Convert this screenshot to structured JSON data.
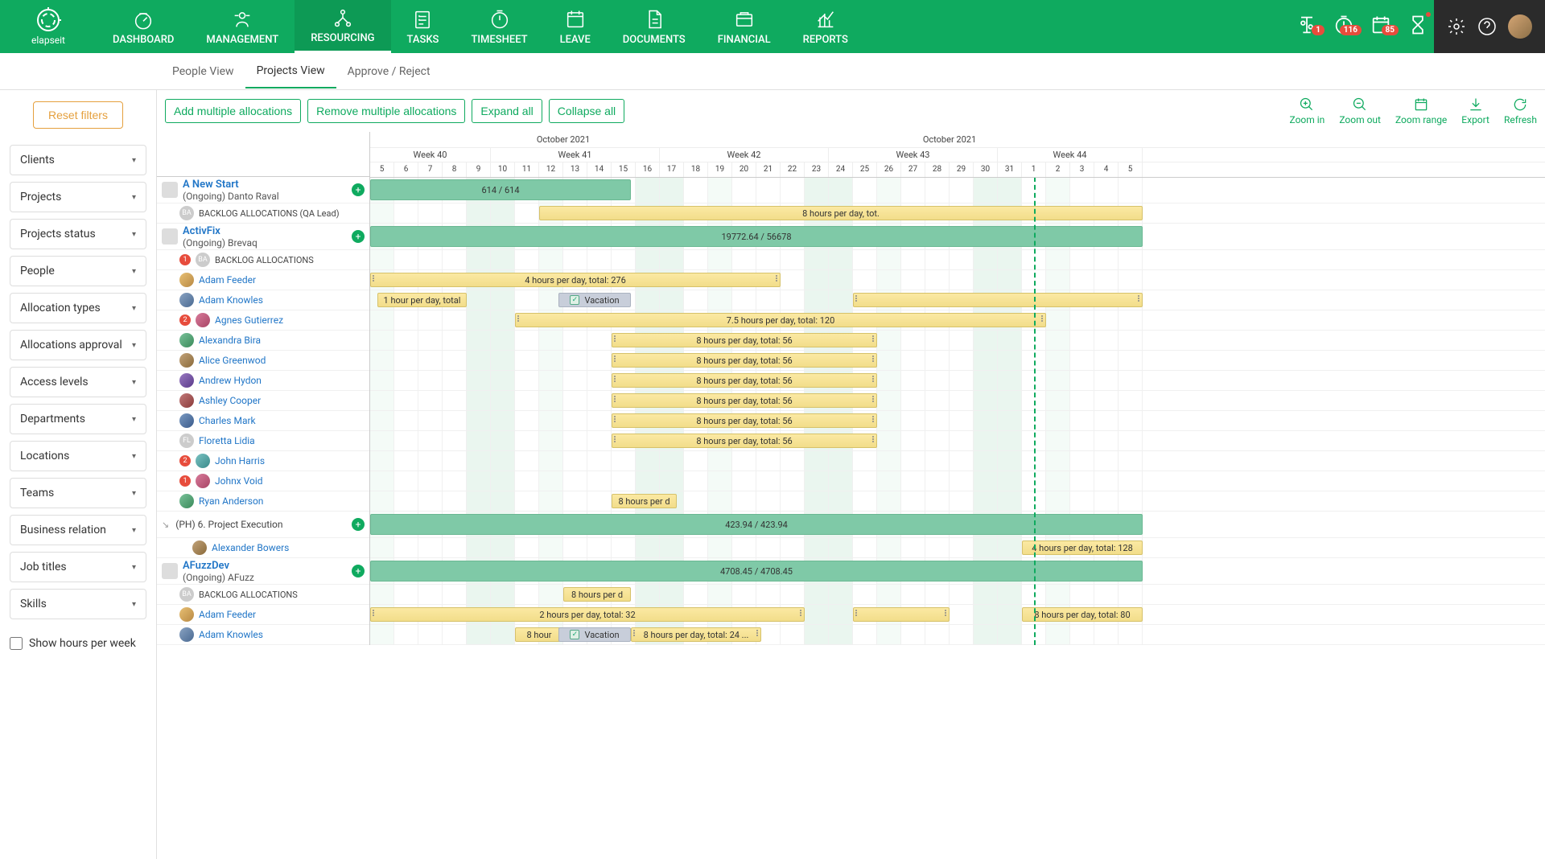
{
  "brand": "elapseit",
  "nav": [
    {
      "label": "DASHBOARD"
    },
    {
      "label": "MANAGEMENT"
    },
    {
      "label": "RESOURCING"
    },
    {
      "label": "TASKS"
    },
    {
      "label": "TIMESHEET"
    },
    {
      "label": "LEAVE"
    },
    {
      "label": "DOCUMENTS"
    },
    {
      "label": "FINANCIAL"
    },
    {
      "label": "REPORTS"
    }
  ],
  "nav_active": 2,
  "header_badges": {
    "bell": "1",
    "timer": "116",
    "cal": "85"
  },
  "sub_tabs": [
    "People View",
    "Projects View",
    "Approve / Reject"
  ],
  "sub_tab_active": 1,
  "toolbar": {
    "add": "Add multiple allocations",
    "remove": "Remove multiple allocations",
    "expand": "Expand all",
    "collapse": "Collapse all",
    "zoom_in": "Zoom in",
    "zoom_out": "Zoom out",
    "zoom_range": "Zoom range",
    "export": "Export",
    "refresh": "Refresh"
  },
  "sidebar": {
    "reset": "Reset filters",
    "filters": [
      "Clients",
      "Projects",
      "Projects status",
      "People",
      "Allocation types",
      "Allocations approval",
      "Access levels",
      "Departments",
      "Locations",
      "Teams",
      "Business relation",
      "Job titles",
      "Skills"
    ],
    "show_hours": "Show hours per week"
  },
  "timeline": {
    "month": "October 2021",
    "weeks": [
      "Week 40",
      "Week 41",
      "Week 42",
      "Week 43",
      "Week 44"
    ],
    "days": [
      "5",
      "6",
      "7",
      "8",
      "9",
      "10",
      "11",
      "12",
      "13",
      "14",
      "15",
      "16",
      "17",
      "18",
      "19",
      "20",
      "21",
      "22",
      "23",
      "24",
      "25",
      "26",
      "27",
      "28",
      "29",
      "30",
      "31",
      "1",
      "2",
      "3",
      "4",
      "5"
    ],
    "weekend_idx": [
      4,
      5,
      11,
      12,
      18,
      19,
      25,
      26
    ],
    "tue_idx": [
      0,
      7,
      14,
      21,
      28
    ],
    "today_idx": 27.5
  },
  "projects": [
    {
      "name": "A New Start",
      "sub": "(Ongoing) Danto Raval",
      "bar": {
        "start": 0,
        "end": 10.8,
        "label": "614 / 614"
      },
      "rows": [
        {
          "type": "ba",
          "label": "BACKLOG ALLOCATIONS (QA Lead)",
          "bars": [
            {
              "start": 7,
              "end": 32,
              "label": "8 hours per day, tot.",
              "cls": "bar-alloc"
            }
          ]
        }
      ]
    },
    {
      "name": "ActivFix",
      "sub": "(Ongoing) Brevaq",
      "bar": {
        "start": 0,
        "end": 32,
        "label": "19772.64 / 56678"
      },
      "rows": [
        {
          "type": "ba",
          "label": "BACKLOG ALLOCATIONS",
          "badge": "1",
          "bars": []
        },
        {
          "type": "person",
          "name": "Adam Feeder",
          "av": "av-1",
          "bars": [
            {
              "start": 0,
              "end": 17,
              "label": "4 hours per day, total: 276",
              "cls": "bar-alloc",
              "handles": true
            }
          ]
        },
        {
          "type": "person",
          "name": "Adam Knowles",
          "av": "av-2",
          "bars": [
            {
              "start": 0.3,
              "end": 4,
              "label": "1 hour per day, total",
              "cls": "bar-alloc"
            },
            {
              "start": 7.8,
              "end": 10.8,
              "label": "Vacation",
              "cls": "bar-vacation",
              "check": true
            },
            {
              "start": 20,
              "end": 32,
              "label": "",
              "cls": "bar-alloc",
              "handles": true
            }
          ]
        },
        {
          "type": "person",
          "name": "Agnes Gutierrez",
          "av": "av-3",
          "badge": "2",
          "bars": [
            {
              "start": 6,
              "end": 28,
              "label": "7.5 hours per day, total: 120",
              "cls": "bar-alloc",
              "handles": true
            }
          ]
        },
        {
          "type": "person",
          "name": "Alexandra Bira",
          "av": "av-4",
          "bars": [
            {
              "start": 10,
              "end": 21,
              "label": "8 hours per day, total: 56",
              "cls": "bar-alloc",
              "handles": true
            }
          ]
        },
        {
          "type": "person",
          "name": "Alice Greenwod",
          "av": "av-5",
          "bars": [
            {
              "start": 10,
              "end": 21,
              "label": "8 hours per day, total: 56",
              "cls": "bar-alloc",
              "handles": true
            }
          ]
        },
        {
          "type": "person",
          "name": "Andrew Hydon",
          "av": "av-6",
          "bars": [
            {
              "start": 10,
              "end": 21,
              "label": "8 hours per day, total: 56",
              "cls": "bar-alloc",
              "handles": true
            }
          ]
        },
        {
          "type": "person",
          "name": "Ashley Cooper",
          "av": "av-7",
          "bars": [
            {
              "start": 10,
              "end": 21,
              "label": "8 hours per day, total: 56",
              "cls": "bar-alloc",
              "handles": true
            }
          ]
        },
        {
          "type": "person",
          "name": "Charles Mark",
          "av": "av-8",
          "bars": [
            {
              "start": 10,
              "end": 21,
              "label": "8 hours per day, total: 56",
              "cls": "bar-alloc",
              "handles": true
            }
          ]
        },
        {
          "type": "person",
          "name": "Floretta Lidia",
          "av": "ba-avatar",
          "initials": "FL",
          "bars": [
            {
              "start": 10,
              "end": 21,
              "label": "8 hours per day, total: 56",
              "cls": "bar-alloc",
              "handles": true
            }
          ]
        },
        {
          "type": "person",
          "name": "John Harris",
          "av": "av-9",
          "badge": "2",
          "bars": []
        },
        {
          "type": "person",
          "name": "Johnx Void",
          "av": "av-3",
          "badge": "1",
          "bars": []
        },
        {
          "type": "person",
          "name": "Ryan Anderson",
          "av": "av-4",
          "bars": [
            {
              "start": 10,
              "end": 12.7,
              "label": "8 hours per d",
              "cls": "bar-alloc"
            }
          ]
        },
        {
          "type": "phase",
          "label": "(PH) 6. Project Execution",
          "bar": {
            "start": 0,
            "end": 32,
            "label": "423.94 / 423.94"
          }
        },
        {
          "type": "person",
          "name": "Alexander Bowers",
          "av": "av-5",
          "indent": true,
          "bars": [
            {
              "start": 27,
              "end": 32,
              "label": "4 hours per day, total: 128",
              "cls": "bar-alloc"
            }
          ]
        }
      ]
    },
    {
      "name": "AFuzzDev",
      "sub": "(Ongoing) AFuzz",
      "bar": {
        "start": 0,
        "end": 32,
        "label": "4708.45 / 4708.45"
      },
      "rows": [
        {
          "type": "ba",
          "label": "BACKLOG ALLOCATIONS",
          "bars": [
            {
              "start": 8,
              "end": 10.8,
              "label": "8 hours per d",
              "cls": "bar-alloc"
            }
          ]
        },
        {
          "type": "person",
          "name": "Adam Feeder",
          "av": "av-1",
          "bars": [
            {
              "start": 0,
              "end": 18,
              "label": "2 hours per day, total: 32",
              "cls": "bar-alloc",
              "handles": true
            },
            {
              "start": 20,
              "end": 24,
              "label": "",
              "cls": "bar-alloc",
              "handles": true
            },
            {
              "start": 27,
              "end": 32,
              "label": "8 hours per day, total: 80",
              "cls": "bar-alloc"
            }
          ]
        },
        {
          "type": "person",
          "name": "Adam Knowles",
          "av": "av-2",
          "bars": [
            {
              "start": 6,
              "end": 8,
              "label": "8 hour",
              "cls": "bar-alloc"
            },
            {
              "start": 7.8,
              "end": 10.8,
              "label": "Vacation",
              "cls": "bar-vacation",
              "check": true
            },
            {
              "start": 10.8,
              "end": 16.2,
              "label": "8 hours per day, total: 24 ...",
              "cls": "bar-alloc",
              "handles": true
            }
          ]
        }
      ]
    }
  ]
}
